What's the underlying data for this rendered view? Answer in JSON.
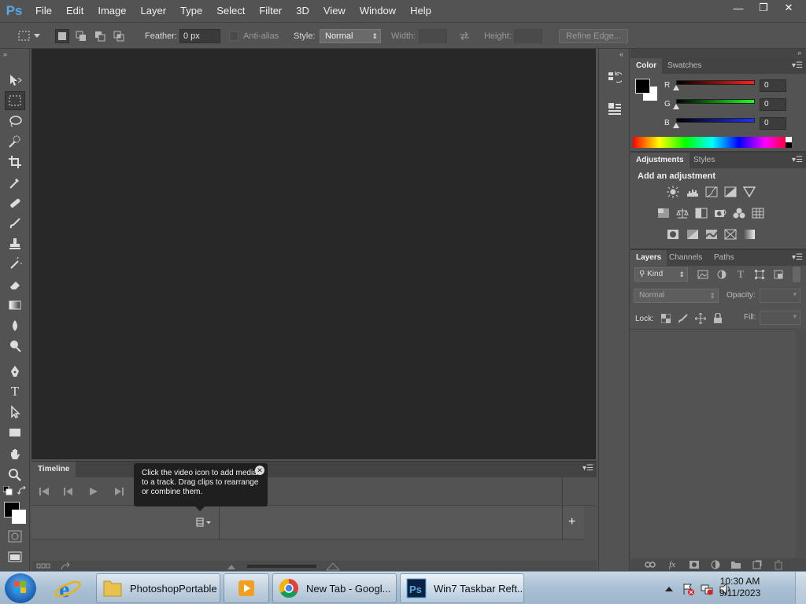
{
  "app": {
    "logo": "Ps",
    "menu": [
      "File",
      "Edit",
      "Image",
      "Layer",
      "Type",
      "Select",
      "Filter",
      "3D",
      "View",
      "Window",
      "Help"
    ],
    "window_controls": {
      "minimize": "—",
      "restore": "❐",
      "close": "✕"
    }
  },
  "options_bar": {
    "feather_label": "Feather:",
    "feather_value": "0 px",
    "anti_alias_label": "Anti-alias",
    "style_label": "Style:",
    "style_value": "Normal",
    "width_label": "Width:",
    "height_label": "Height:",
    "refine_edge_label": "Refine Edge..."
  },
  "timeline": {
    "tab_label": "Timeline",
    "tooltip": "Click the video icon to add media to a track. Drag clips to rearrange or combine them.",
    "add_label": "+"
  },
  "color_panel": {
    "tabs": [
      "Color",
      "Swatches"
    ],
    "foreground": "#000000",
    "background": "#ffffff",
    "channels": [
      {
        "label": "R",
        "value": "0",
        "color": "#e02020"
      },
      {
        "label": "G",
        "value": "0",
        "color": "#20c020"
      },
      {
        "label": "B",
        "value": "0",
        "color": "#2020e0"
      }
    ]
  },
  "adjustments_panel": {
    "tabs": [
      "Adjustments",
      "Styles"
    ],
    "title": "Add an adjustment"
  },
  "layers_panel": {
    "tabs": [
      "Layers",
      "Channels",
      "Paths"
    ],
    "kind_label": "Kind",
    "blend_mode": "Normal",
    "opacity_label": "Opacity:",
    "lock_label": "Lock:",
    "fill_label": "Fill:"
  },
  "taskbar": {
    "buttons": [
      {
        "label": "PhotoshopPortable"
      },
      {
        "label": ""
      },
      {
        "label": "New Tab - Googl..."
      },
      {
        "label": "Win7 Taskbar Reft..."
      }
    ],
    "time": "10:30 AM",
    "date": "9/11/2023"
  },
  "colors": {
    "ui_bg": "#535353",
    "canvas_bg": "#282828",
    "accent_blue": "#5aa7e6"
  }
}
